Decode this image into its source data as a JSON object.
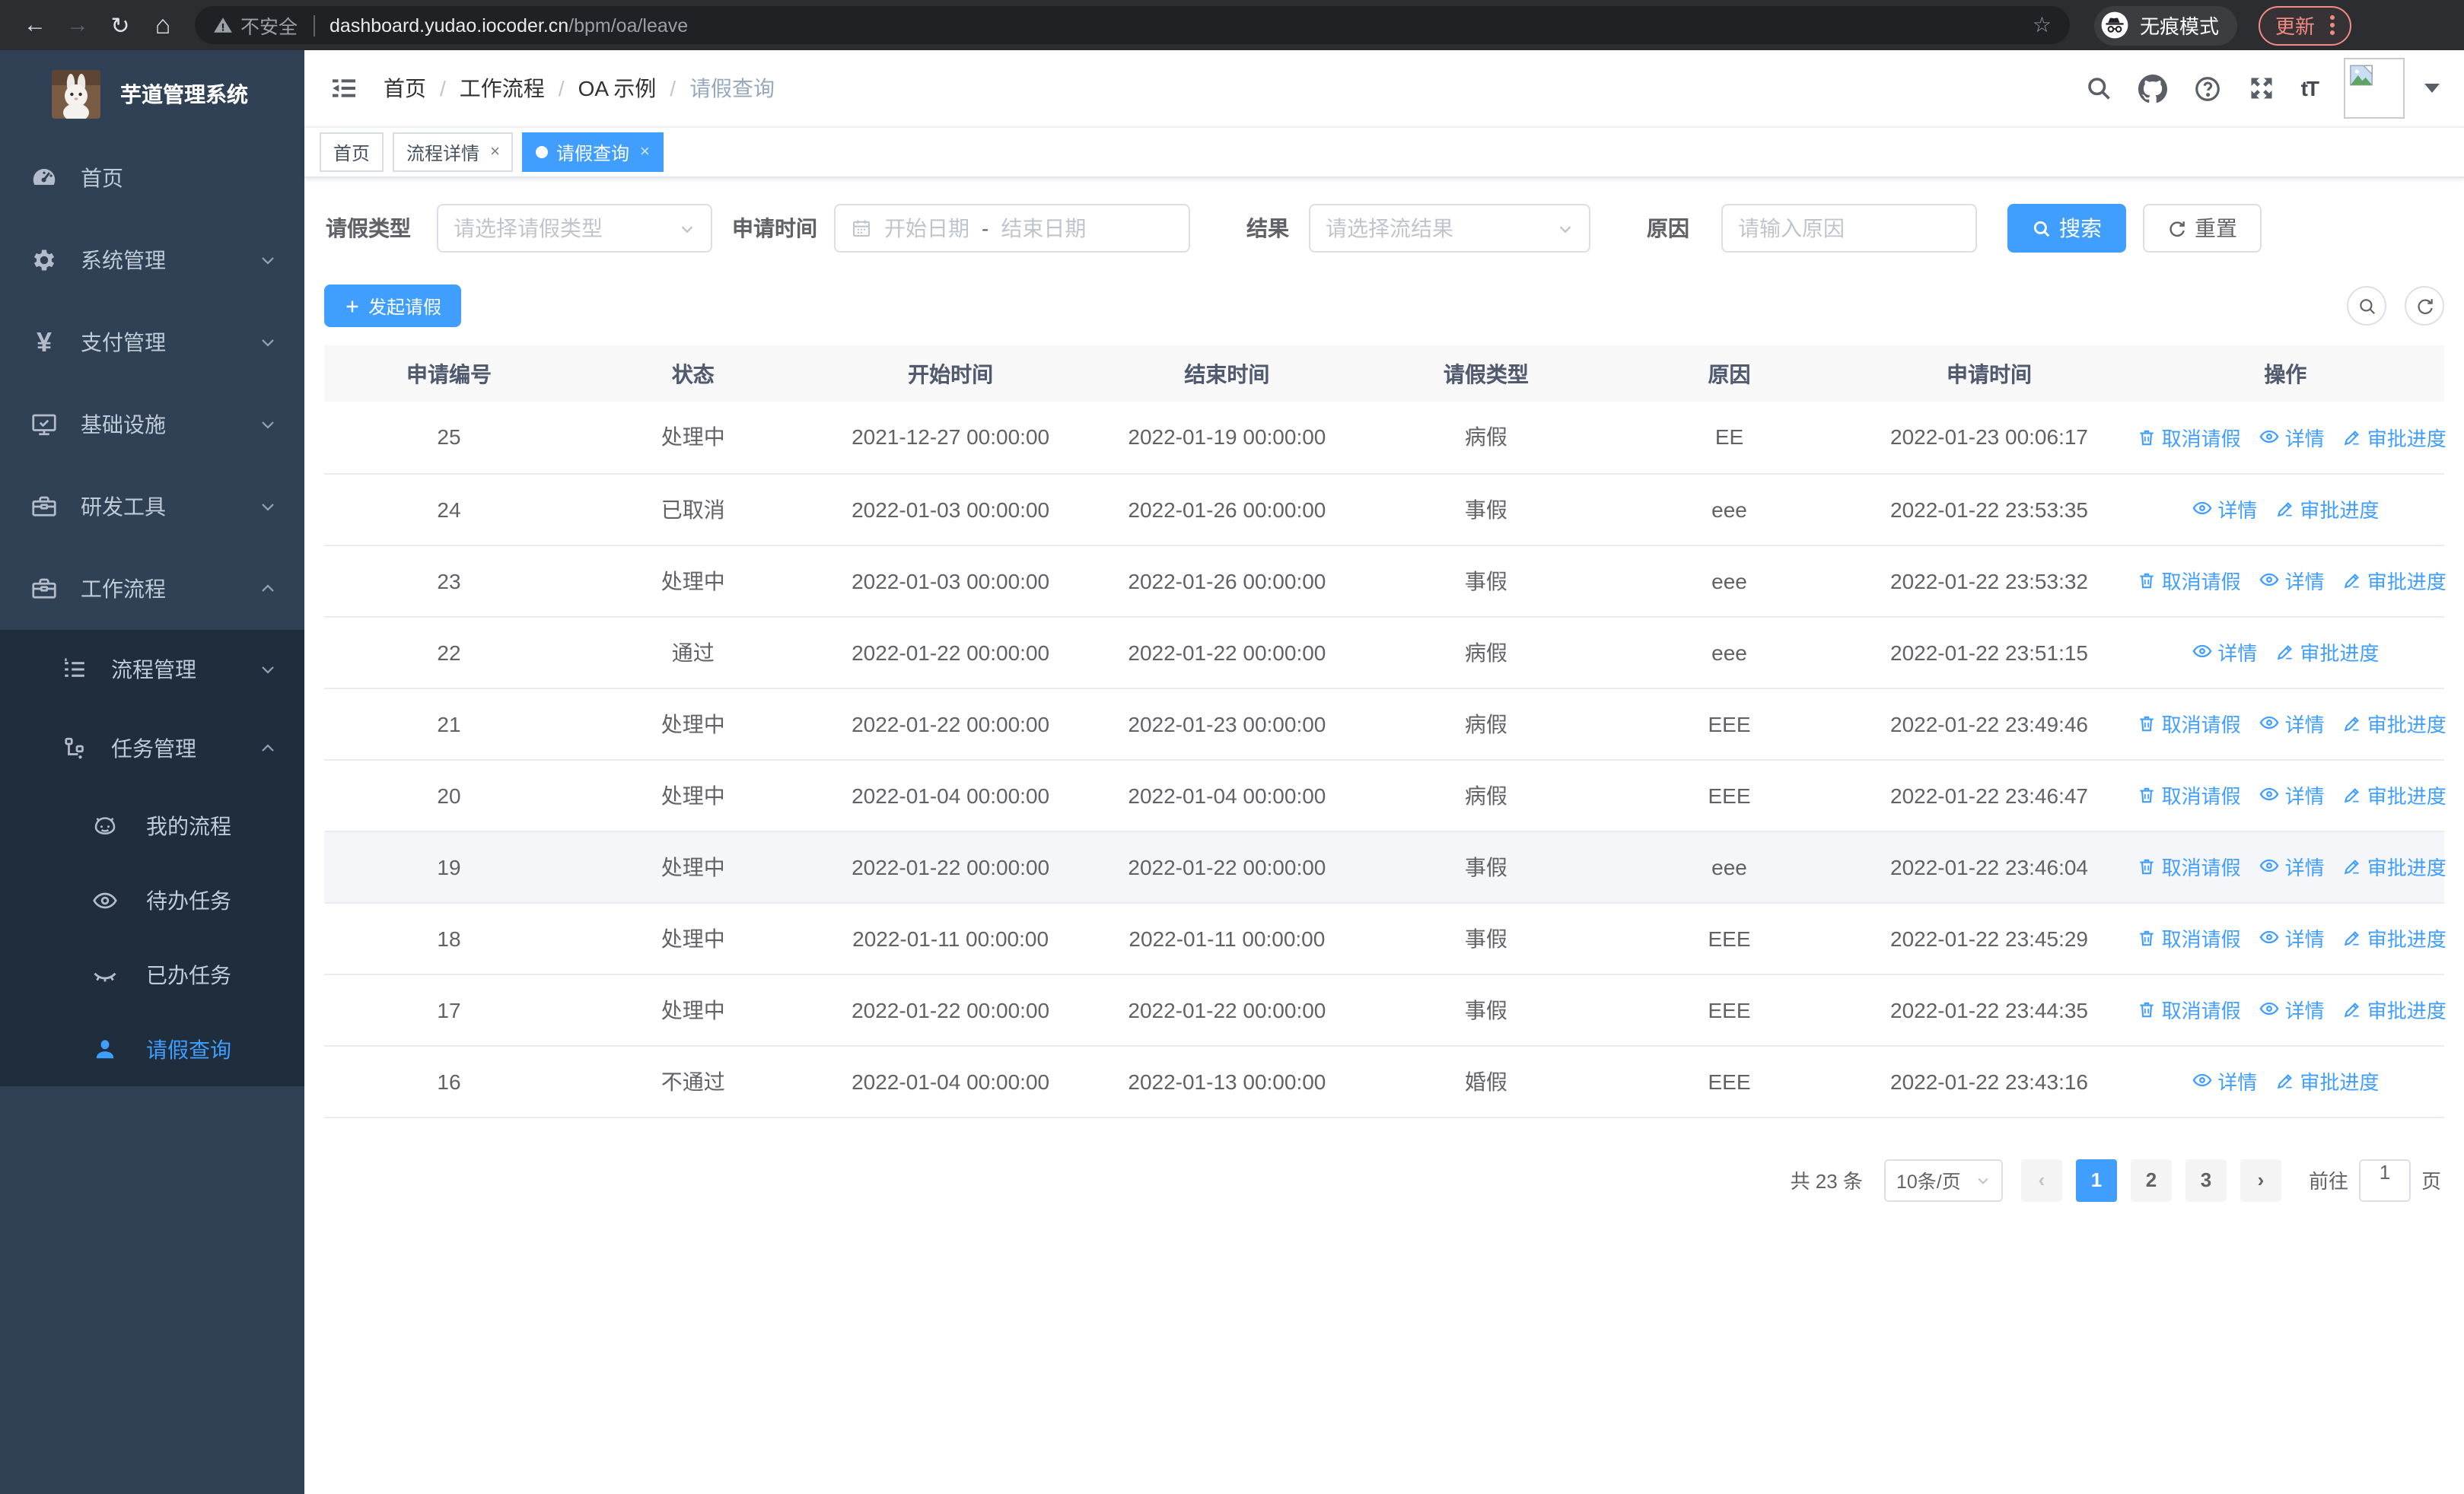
{
  "browser": {
    "security_label": "不安全",
    "url_host": "dashboard.yudao.iocoder.cn",
    "url_path": "/bpm/oa/leave",
    "incognito_label": "无痕模式",
    "update_label": "更新"
  },
  "sidebar": {
    "app_title": "芋道管理系统",
    "items": [
      {
        "key": "home",
        "label": "首页",
        "icon": "dashboard",
        "level": 1,
        "dark": false,
        "chevron": null,
        "active": false
      },
      {
        "key": "system",
        "label": "系统管理",
        "icon": "gear",
        "level": 1,
        "dark": false,
        "chevron": "down",
        "active": false
      },
      {
        "key": "payment",
        "label": "支付管理",
        "icon": "yen",
        "level": 1,
        "dark": false,
        "chevron": "down",
        "active": false
      },
      {
        "key": "infrastructure",
        "label": "基础设施",
        "icon": "monitor",
        "level": 1,
        "dark": false,
        "chevron": "down",
        "active": false
      },
      {
        "key": "dev-tools",
        "label": "研发工具",
        "icon": "toolbox",
        "level": 1,
        "dark": false,
        "chevron": "down",
        "active": false
      },
      {
        "key": "workflow",
        "label": "工作流程",
        "icon": "toolbox",
        "level": 1,
        "dark": false,
        "chevron": "up",
        "active": false
      },
      {
        "key": "process-management",
        "label": "流程管理",
        "icon": "list",
        "level": 2,
        "dark": true,
        "chevron": "down",
        "active": false
      },
      {
        "key": "task-management",
        "label": "任务管理",
        "icon": "flow",
        "level": 2,
        "dark": true,
        "chevron": "up",
        "active": false
      },
      {
        "key": "my-process",
        "label": "我的流程",
        "icon": "robot",
        "level": 3,
        "dark": true,
        "chevron": null,
        "active": false
      },
      {
        "key": "todo-tasks",
        "label": "待办任务",
        "icon": "eye-open",
        "level": 3,
        "dark": true,
        "chevron": null,
        "active": false
      },
      {
        "key": "done-tasks",
        "label": "已办任务",
        "icon": "eye-closed",
        "level": 3,
        "dark": true,
        "chevron": null,
        "active": false
      },
      {
        "key": "leave-query",
        "label": "请假查询",
        "icon": "user",
        "level": 3,
        "dark": true,
        "chevron": null,
        "active": true
      }
    ]
  },
  "header": {
    "breadcrumb": [
      "首页",
      "工作流程",
      "OA 示例",
      "请假查询"
    ]
  },
  "tabs": [
    {
      "label": "首页",
      "closable": false,
      "active": false
    },
    {
      "label": "流程详情",
      "closable": true,
      "active": false
    },
    {
      "label": "请假查询",
      "closable": true,
      "active": true
    }
  ],
  "filters": {
    "leave_type_label": "请假类型",
    "leave_type_placeholder": "请选择请假类型",
    "apply_time_label": "申请时间",
    "start_date_placeholder": "开始日期",
    "range_separator": "-",
    "end_date_placeholder": "结束日期",
    "result_label": "结果",
    "result_placeholder": "请选择流结果",
    "reason_label": "原因",
    "reason_placeholder": "请输入原因",
    "search_label": "搜索",
    "reset_label": "重置"
  },
  "toolbar": {
    "create_label": "发起请假"
  },
  "table": {
    "columns": [
      "申请编号",
      "状态",
      "开始时间",
      "结束时间",
      "请假类型",
      "原因",
      "申请时间",
      "操作"
    ],
    "action_labels": {
      "cancel": "取消请假",
      "detail": "详情",
      "progress": "审批进度"
    },
    "rows": [
      {
        "id": "25",
        "status": "处理中",
        "start": "2021-12-27 00:00:00",
        "end": "2022-01-19 00:00:00",
        "type": "病假",
        "reason": "EE",
        "apply_time": "2022-01-23 00:06:17",
        "actions": [
          "cancel",
          "detail",
          "progress"
        ],
        "highlight": false
      },
      {
        "id": "24",
        "status": "已取消",
        "start": "2022-01-03 00:00:00",
        "end": "2022-01-26 00:00:00",
        "type": "事假",
        "reason": "eee",
        "apply_time": "2022-01-22 23:53:35",
        "actions": [
          "detail",
          "progress"
        ],
        "highlight": false
      },
      {
        "id": "23",
        "status": "处理中",
        "start": "2022-01-03 00:00:00",
        "end": "2022-01-26 00:00:00",
        "type": "事假",
        "reason": "eee",
        "apply_time": "2022-01-22 23:53:32",
        "actions": [
          "cancel",
          "detail",
          "progress"
        ],
        "highlight": false
      },
      {
        "id": "22",
        "status": "通过",
        "start": "2022-01-22 00:00:00",
        "end": "2022-01-22 00:00:00",
        "type": "病假",
        "reason": "eee",
        "apply_time": "2022-01-22 23:51:15",
        "actions": [
          "detail",
          "progress"
        ],
        "highlight": false
      },
      {
        "id": "21",
        "status": "处理中",
        "start": "2022-01-22 00:00:00",
        "end": "2022-01-23 00:00:00",
        "type": "病假",
        "reason": "EEE",
        "apply_time": "2022-01-22 23:49:46",
        "actions": [
          "cancel",
          "detail",
          "progress"
        ],
        "highlight": false
      },
      {
        "id": "20",
        "status": "处理中",
        "start": "2022-01-04 00:00:00",
        "end": "2022-01-04 00:00:00",
        "type": "病假",
        "reason": "EEE",
        "apply_time": "2022-01-22 23:46:47",
        "actions": [
          "cancel",
          "detail",
          "progress"
        ],
        "highlight": false
      },
      {
        "id": "19",
        "status": "处理中",
        "start": "2022-01-22 00:00:00",
        "end": "2022-01-22 00:00:00",
        "type": "事假",
        "reason": "eee",
        "apply_time": "2022-01-22 23:46:04",
        "actions": [
          "cancel",
          "detail",
          "progress"
        ],
        "highlight": true
      },
      {
        "id": "18",
        "status": "处理中",
        "start": "2022-01-11 00:00:00",
        "end": "2022-01-11 00:00:00",
        "type": "事假",
        "reason": "EEE",
        "apply_time": "2022-01-22 23:45:29",
        "actions": [
          "cancel",
          "detail",
          "progress"
        ],
        "highlight": false
      },
      {
        "id": "17",
        "status": "处理中",
        "start": "2022-01-22 00:00:00",
        "end": "2022-01-22 00:00:00",
        "type": "事假",
        "reason": "EEE",
        "apply_time": "2022-01-22 23:44:35",
        "actions": [
          "cancel",
          "detail",
          "progress"
        ],
        "highlight": false
      },
      {
        "id": "16",
        "status": "不通过",
        "start": "2022-01-04 00:00:00",
        "end": "2022-01-13 00:00:00",
        "type": "婚假",
        "reason": "EEE",
        "apply_time": "2022-01-22 23:43:16",
        "actions": [
          "detail",
          "progress"
        ],
        "highlight": false
      }
    ]
  },
  "pagination": {
    "total_label": "共 23 条",
    "page_size_label": "10条/页",
    "pages": [
      "1",
      "2",
      "3"
    ],
    "active_page": "1",
    "goto_label": "前往",
    "goto_value": "1",
    "goto_suffix": "页"
  },
  "colors": {
    "accent": "#409eff",
    "sidebar_bg": "#304156",
    "sidebar_submenu_bg": "#1f2d3d",
    "sidebar_text": "#bfcbd9",
    "update_chip": "#f28b82",
    "table_header_bg": "#f8f8f9"
  }
}
